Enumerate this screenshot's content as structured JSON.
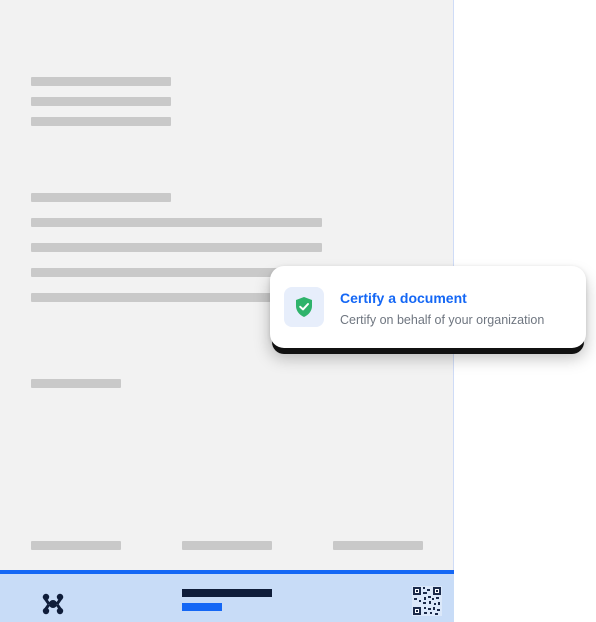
{
  "certify_card": {
    "title": "Certify a document",
    "subtitle": "Certify on behalf of your organization"
  },
  "icons": {
    "card": "shield-check-icon",
    "footer_logo": "brand-logo-icon",
    "footer_code": "qr-code-icon"
  },
  "colors": {
    "accent_blue": "#1467f5",
    "footer_bg": "#c8dcf7",
    "shield_green": "#2fb36b",
    "navy": "#0f1d3a"
  }
}
